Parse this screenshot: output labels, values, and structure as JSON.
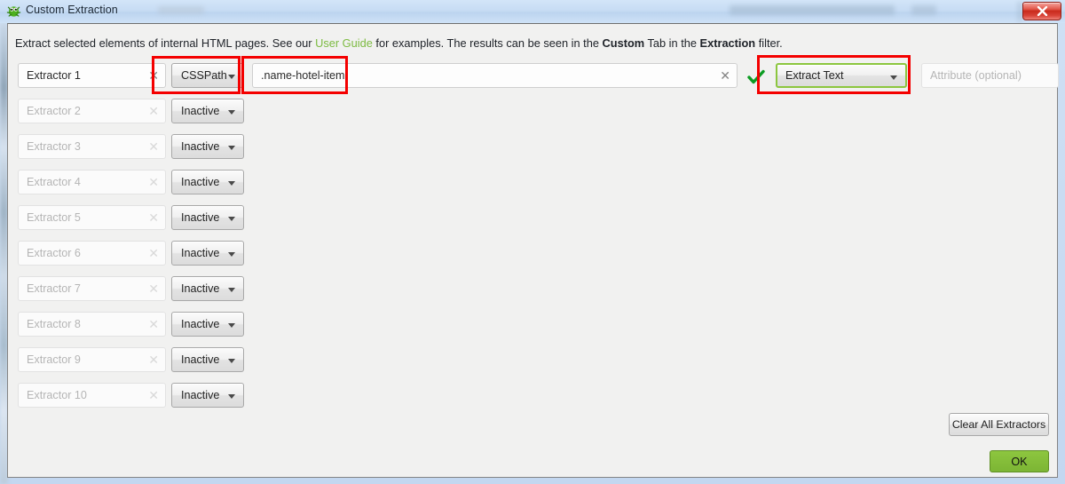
{
  "window": {
    "title": "Custom Extraction",
    "icon": "spider-logo-icon",
    "close_label": "X"
  },
  "description": {
    "part1": "Extract selected elements of internal HTML pages. See our ",
    "link": "User Guide",
    "part2": " for examples. The results can be seen in the ",
    "bold1": "Custom",
    "part3": " Tab in the ",
    "bold2": "Extraction",
    "part4": " filter."
  },
  "fields": {
    "value_placeholder": "",
    "attribute_placeholder": "Attribute (optional)",
    "clear_glyph": "✕"
  },
  "rows": [
    {
      "name": "Extractor 1",
      "active": true,
      "type": "CSSPath",
      "value": ".name-hotel-item",
      "mode": "Extract Text",
      "attribute": "",
      "valid": true
    },
    {
      "name": "Extractor 2",
      "active": false,
      "type": "Inactive"
    },
    {
      "name": "Extractor 3",
      "active": false,
      "type": "Inactive"
    },
    {
      "name": "Extractor 4",
      "active": false,
      "type": "Inactive"
    },
    {
      "name": "Extractor 5",
      "active": false,
      "type": "Inactive"
    },
    {
      "name": "Extractor 6",
      "active": false,
      "type": "Inactive"
    },
    {
      "name": "Extractor 7",
      "active": false,
      "type": "Inactive"
    },
    {
      "name": "Extractor 8",
      "active": false,
      "type": "Inactive"
    },
    {
      "name": "Extractor 9",
      "active": false,
      "type": "Inactive"
    },
    {
      "name": "Extractor 10",
      "active": false,
      "type": "Inactive"
    }
  ],
  "buttons": {
    "clear_all": "Clear All Extractors",
    "ok": "OK"
  },
  "annotations": {
    "color": "#f40000",
    "highlight_color": "#8cc63f",
    "boxes": [
      {
        "name": "csspath-dropdown-highlight"
      },
      {
        "name": "selector-value-highlight"
      },
      {
        "name": "extract-text-dropdown-highlight"
      }
    ]
  },
  "colors": {
    "link": "#7dbb42",
    "ok_button": "#8dc63f",
    "close_button": "#c92a1c",
    "annotation": "#f40000"
  }
}
